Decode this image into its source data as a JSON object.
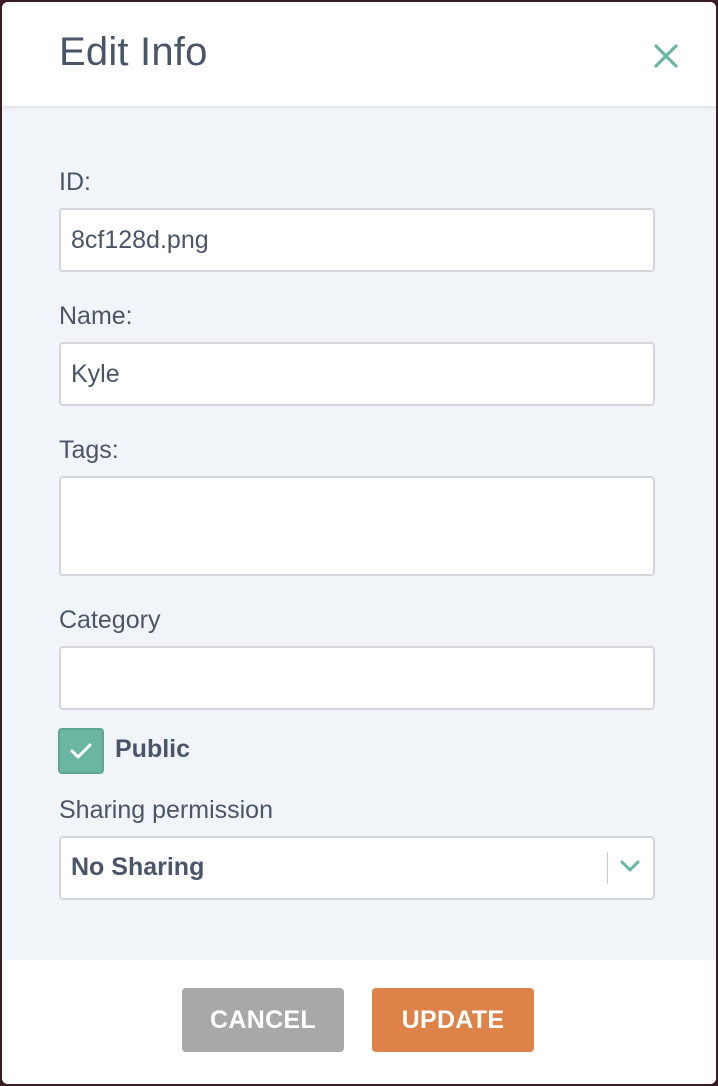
{
  "dialog": {
    "title": "Edit Info",
    "close_icon": "close-icon"
  },
  "form": {
    "id": {
      "label": "ID:",
      "value": "8cf128d.png"
    },
    "name": {
      "label": "Name:",
      "value": "Kyle"
    },
    "tags": {
      "label": "Tags:",
      "value": ""
    },
    "category": {
      "label": "Category",
      "value": ""
    },
    "public": {
      "label": "Public",
      "checked": true
    },
    "sharing": {
      "label": "Sharing permission",
      "selected": "No Sharing"
    }
  },
  "footer": {
    "cancel_label": "CANCEL",
    "update_label": "UPDATE"
  },
  "colors": {
    "accent": "#6bb6a2",
    "update": "#dd8248",
    "cancel": "#a8a8a8",
    "text": "#4a5668",
    "body_bg": "#f1f5fa"
  }
}
